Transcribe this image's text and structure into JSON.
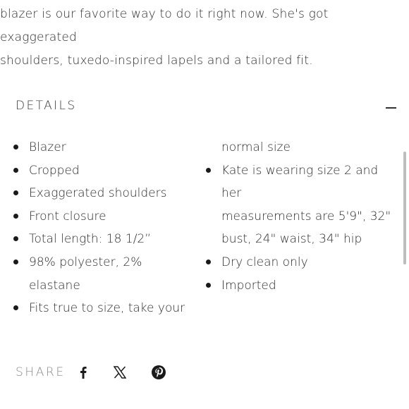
{
  "intro": {
    "line1": "blazer is our favorite way to do it right now. She's got exaggerated",
    "line2": "shoulders, tuxedo-inspired lapels and a tailored fit."
  },
  "details": {
    "title": "DETAILS",
    "left_items": [
      "Blazer",
      "Cropped",
      "Exaggerated shoulders",
      "Front closure",
      "Total length: 18 1/2”",
      "98% polyester, 2% elastane",
      "Fits true to size, take your"
    ],
    "right_items": [
      "normal size",
      "Kate is wearing size 2 and her",
      "measurements are 5'9\", 32\"",
      "bust, 24\" waist, 34\" hip",
      "Dry clean only",
      "Imported"
    ]
  },
  "share": {
    "label": "SHARE",
    "icons": [
      "facebook-icon",
      "x-icon",
      "pinterest-icon"
    ]
  },
  "colors": {
    "text": "#2b2b2b",
    "muted": "#8a8a8a",
    "scrollbar": "#bdbdbd"
  }
}
